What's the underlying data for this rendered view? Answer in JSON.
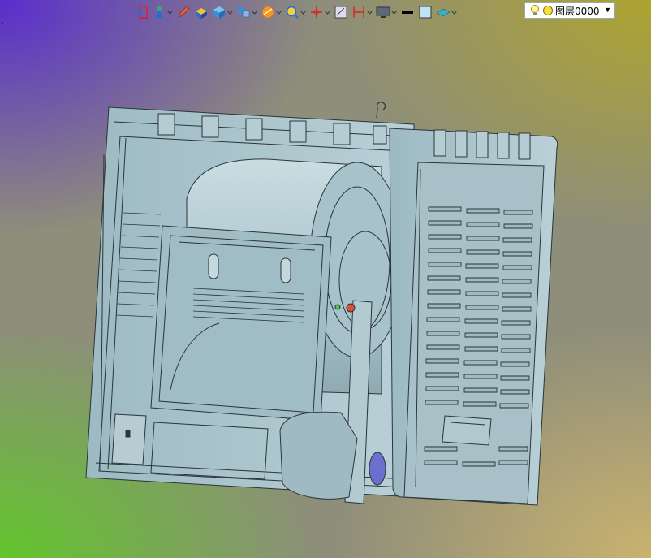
{
  "toolbar": {
    "items": [
      {
        "icon": "exit-door-icon",
        "has_dropdown": false
      },
      {
        "icon": "person-tool-icon",
        "has_dropdown": true
      },
      {
        "icon": "pencil-icon",
        "has_dropdown": false
      },
      {
        "icon": "shaded-solid-icon",
        "has_dropdown": false
      },
      {
        "icon": "cube-icon",
        "has_dropdown": true
      },
      {
        "icon": "view-orientation-icon",
        "has_dropdown": true
      },
      {
        "icon": "render-mode-icon",
        "has_dropdown": true
      },
      {
        "icon": "zoom-icon",
        "has_dropdown": true
      },
      {
        "icon": "axis-icon",
        "has_dropdown": true
      },
      {
        "icon": "section-view-icon",
        "has_dropdown": false
      },
      {
        "icon": "measure-icon",
        "has_dropdown": true
      },
      {
        "icon": "display-icon",
        "has_dropdown": true
      },
      {
        "icon": "line-weight-icon",
        "has_dropdown": false
      },
      {
        "icon": "color-swatch-icon",
        "has_dropdown": false
      },
      {
        "icon": "layer-tool-icon",
        "has_dropdown": true
      }
    ]
  },
  "layer_select": {
    "value": "图层0000",
    "bulb_icon": "lightbulb-icon",
    "status_icon": "yellow-dot-icon"
  },
  "colors": {
    "model_fill": "#a9c4cc",
    "model_line": "#2b3538",
    "bg_top_left": "#5628d2",
    "bg_bottom_left": "#5fc828",
    "bg_top_right": "#afa52d",
    "bg_bottom_right": "#cdb46e"
  }
}
